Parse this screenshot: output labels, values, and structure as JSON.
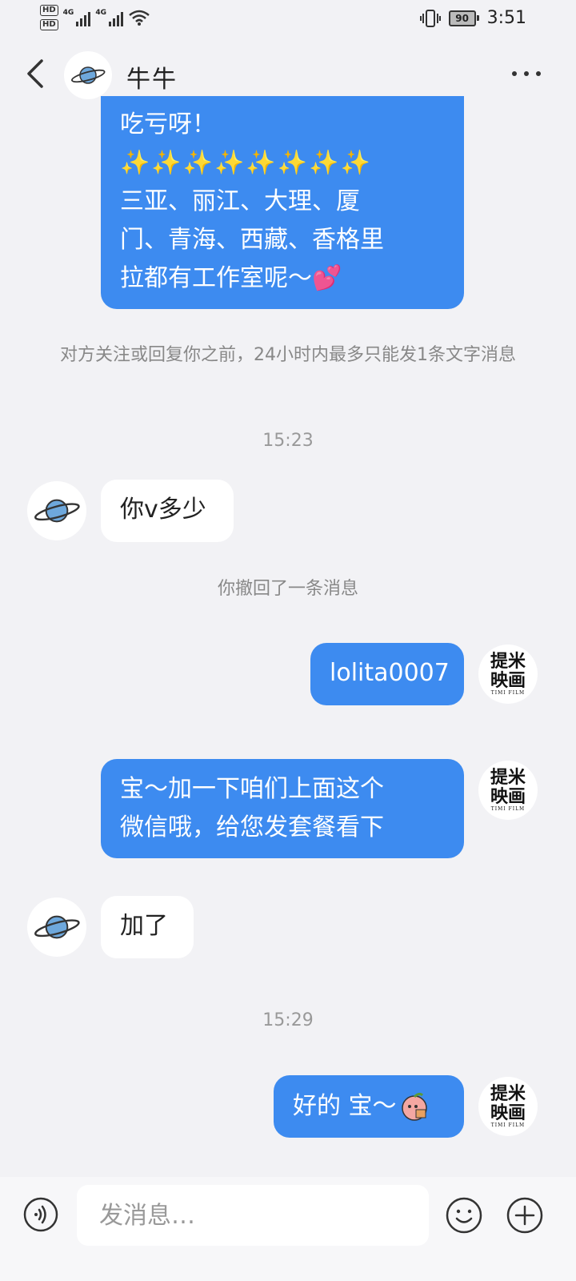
{
  "status_bar": {
    "hd1": "HD",
    "hd2": "HD",
    "net1": "4G",
    "net2": "4G",
    "battery": "90",
    "time": "3:51"
  },
  "header": {
    "title": "牛牛"
  },
  "messages": {
    "m1_line1": "吃亏呀！",
    "m1_sparkles": "✨✨✨✨✨✨✨✨",
    "m1_line3": "三亚、丽江、大理、厦",
    "m1_line4": "门、青海、西藏、香格里",
    "m1_line5": "拉都有工作室呢～💕",
    "sys_notice": "对方关注或回复你之前，24小时内最多只能发1条文字消息",
    "time1": "15:23",
    "m2": "你v多少",
    "recall": "你撤回了一条消息",
    "m3": "lolita0007",
    "m4_line1": "宝～加一下咱们上面这个",
    "m4_line2": "微信哦，给您发套餐看下",
    "m5": "加了",
    "time2": "15:29",
    "m6": "好的 宝～"
  },
  "self_avatar": {
    "line1": "提米",
    "line2": "映画",
    "small": "TIMI FILM"
  },
  "icons": {
    "back": "back-arrow-icon",
    "more": "more-icon",
    "planet": "planet-icon",
    "voice": "voice-icon",
    "emoji": "emoji-icon",
    "plus": "plus-icon",
    "peach_sticker": "peach-sticker-icon"
  },
  "composer": {
    "placeholder": "发消息…"
  },
  "colors": {
    "outgoing_bubble": "#3d8bf0",
    "incoming_bubble": "#ffffff",
    "background": "#f2f2f5"
  }
}
